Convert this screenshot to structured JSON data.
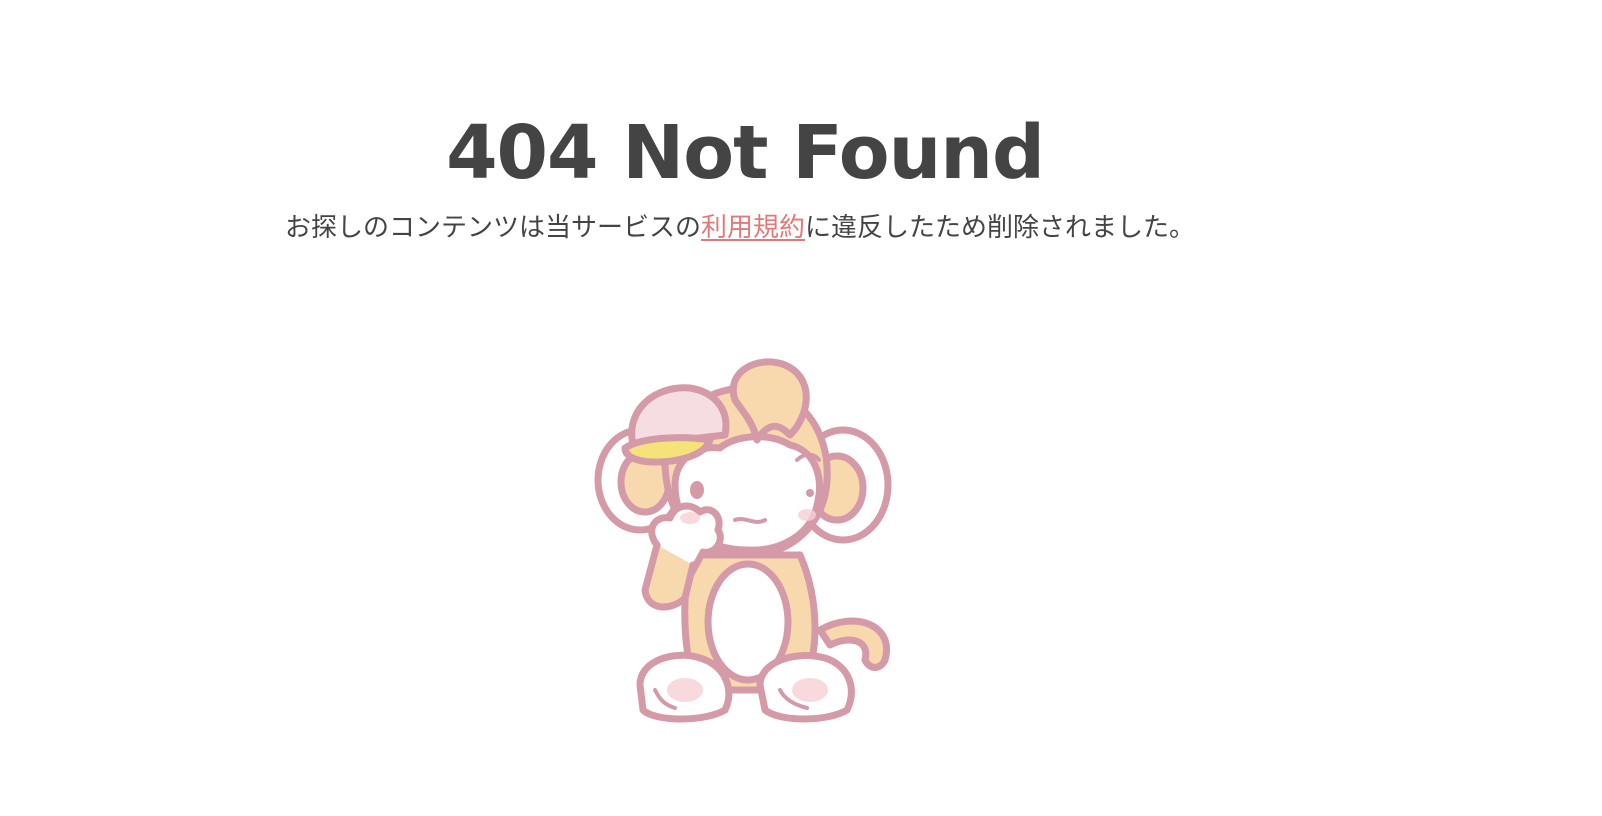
{
  "error": {
    "title": "404 Not Found",
    "message_before": "お探しのコンテンツは当サービスの",
    "terms_link": "利用規約",
    "message_after": "に違反したため削除されました。"
  },
  "colors": {
    "text": "#444444",
    "link": "#e07a7a",
    "outline": "#d49aa8",
    "fur": "#f8d9ae",
    "cap": "#f6dde2",
    "cap_brim": "#f6e27a"
  },
  "illustration": {
    "icon": "monkey-mascot-icon"
  }
}
